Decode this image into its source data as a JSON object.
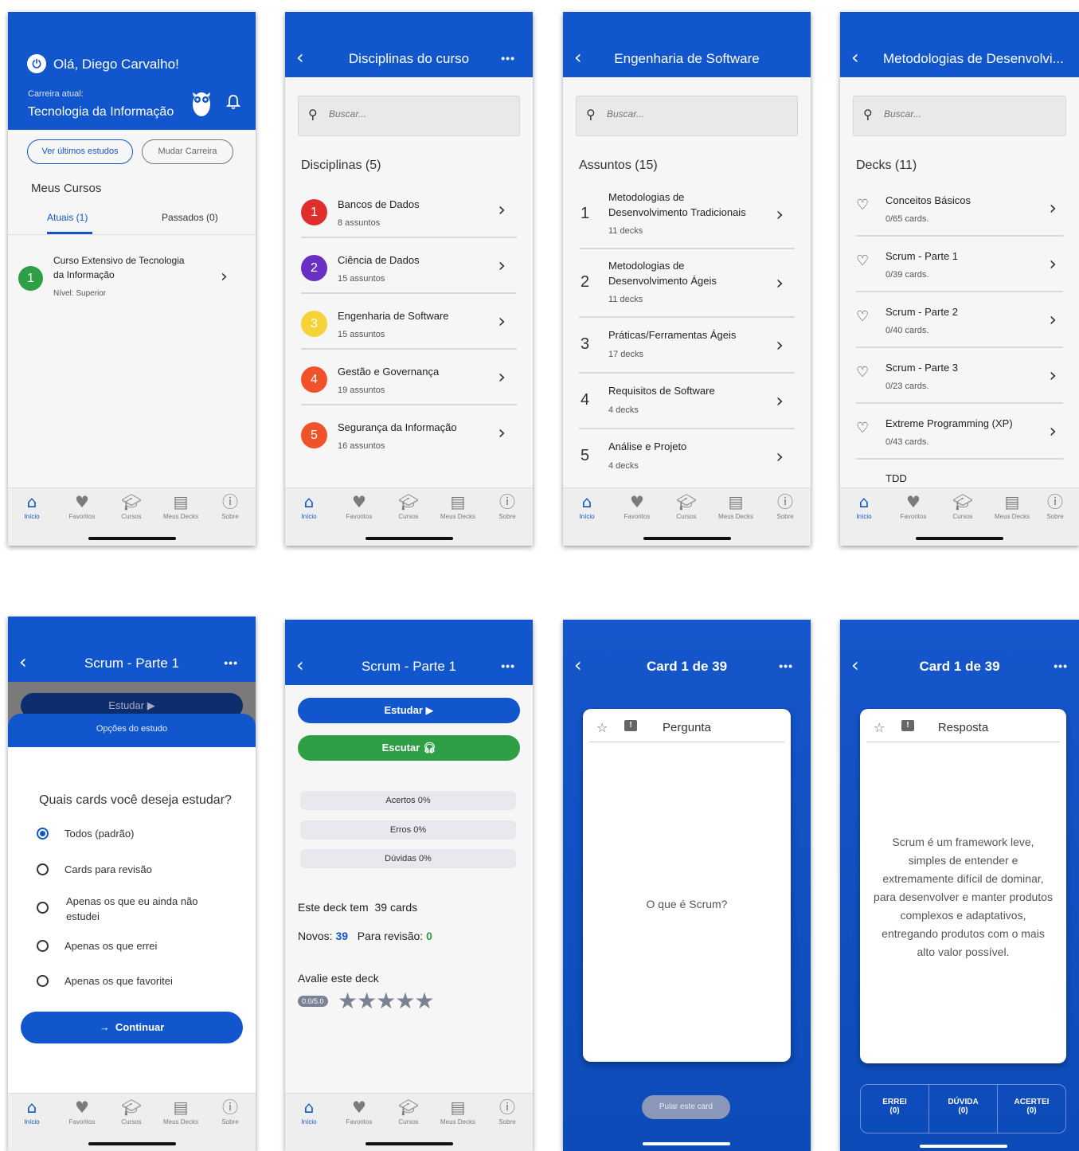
{
  "nav": {
    "home": "Início",
    "fav": "Favoritos",
    "courses": "Cursos",
    "decks": "Meus Decks",
    "about": "Sobre"
  },
  "s1": {
    "greeting": "Olá, Diego Carvalho!",
    "career_label": "Carreira atual:",
    "career": "Tecnologia da Informação",
    "btn_recent": "Ver últimos estudos",
    "btn_change": "Mudar Carreira",
    "section": "Meus Cursos",
    "tab_current": "Atuais (1)",
    "tab_past": "Passados (0)",
    "course": {
      "num": "1",
      "title1": "Curso Extensivo de Tecnologia",
      "title2": "da Informação",
      "level": "Nível: Superior"
    }
  },
  "s2": {
    "title": "Disciplinas do curso",
    "search": "Buscar...",
    "section": "Disciplinas (5)",
    "items": [
      {
        "num": "1",
        "name": "Bancos de Dados",
        "sub": "8 assuntos",
        "color": "#e02d2d"
      },
      {
        "num": "2",
        "name": "Ciência de Dados",
        "sub": "15 assuntos",
        "color": "#6a30c4"
      },
      {
        "num": "3",
        "name": "Engenharia de Software",
        "sub": "15 assuntos",
        "color": "#f5d43a"
      },
      {
        "num": "4",
        "name": "Gestão e Governança",
        "sub": "19 assuntos",
        "color": "#f0532a"
      },
      {
        "num": "5",
        "name": "Segurança da Informação",
        "sub": "16 assuntos",
        "color": "#f0532a"
      }
    ]
  },
  "s3": {
    "title": "Engenharia de Software",
    "search": "Buscar...",
    "section": "Assuntos (15)",
    "items": [
      {
        "num": "1",
        "l1": "Metodologias de",
        "l2": "Desenvolvimento Tradicionais",
        "sub": "11 decks"
      },
      {
        "num": "2",
        "l1": "Metodologias de",
        "l2": "Desenvolvimento Ágeis",
        "sub": "11 decks"
      },
      {
        "num": "3",
        "l1": "Práticas/Ferramentas Ágeis",
        "l2": "",
        "sub": "17 decks"
      },
      {
        "num": "4",
        "l1": "Requisitos de Software",
        "l2": "",
        "sub": "4 decks"
      },
      {
        "num": "5",
        "l1": "Análise e Projeto",
        "l2": "",
        "sub": "4 decks"
      }
    ]
  },
  "s4": {
    "title": "Metodologias de Desenvolvi...",
    "search": "Buscar...",
    "section": "Decks (11)",
    "items": [
      {
        "name": "Conceitos Básicos",
        "sub": "0/65 cards."
      },
      {
        "name": "Scrum - Parte 1",
        "sub": "0/39 cards."
      },
      {
        "name": "Scrum - Parte 2",
        "sub": "0/40 cards."
      },
      {
        "name": "Scrum - Parte 3",
        "sub": "0/23 cards."
      },
      {
        "name": "Extreme Programming (XP)",
        "sub": "0/43 cards."
      },
      {
        "name": "TDD",
        "sub": ""
      }
    ]
  },
  "s5": {
    "title": "Scrum - Parte 1",
    "study": "Estudar",
    "sheet_title": "Opções do estudo",
    "question": "Quais cards você deseja estudar?",
    "options": [
      "Todos (padrão)",
      "Cards para revisão",
      "Apenas os que eu ainda não estudei",
      "Apenas os que errei",
      "Apenas os que favoritei"
    ],
    "continue": "Continuar"
  },
  "s6": {
    "title": "Scrum - Parte 1",
    "study": "Estudar",
    "listen": "Escutar",
    "hits": "Acertos 0%",
    "errors": "Erros 0%",
    "doubts": "Dúvidas 0%",
    "deck_has": "Este deck tem",
    "deck_count": "39 cards",
    "new_label": "Novos:",
    "new_val": "39",
    "review_label": "Para revisão:",
    "review_val": "0",
    "rate": "Avalie este deck",
    "rating": "0.0/5.0",
    "stars_filled": 0
  },
  "s7": {
    "title": "Card 1 de 39",
    "card_label": "Pergunta",
    "question": "O que é Scrum?",
    "skip": "Pular este card"
  },
  "s8": {
    "title": "Card 1 de 39",
    "card_label": "Resposta",
    "answer": "Scrum é um framework leve, simples de entender e extremamente difícil de dominar, para desenvolver e manter produtos complexos e adaptativos, entregando produtos com o mais alto valor possível.",
    "wrong": "ERREI",
    "wrong_n": "(0)",
    "doubt": "DÚVIDA",
    "doubt_n": "(0)",
    "right": "ACERTEI",
    "right_n": "(0)"
  },
  "colors": {
    "primary": "#1156cc",
    "green": "#2e9f45",
    "new": "#1156cc",
    "review": "#2e9f45"
  }
}
